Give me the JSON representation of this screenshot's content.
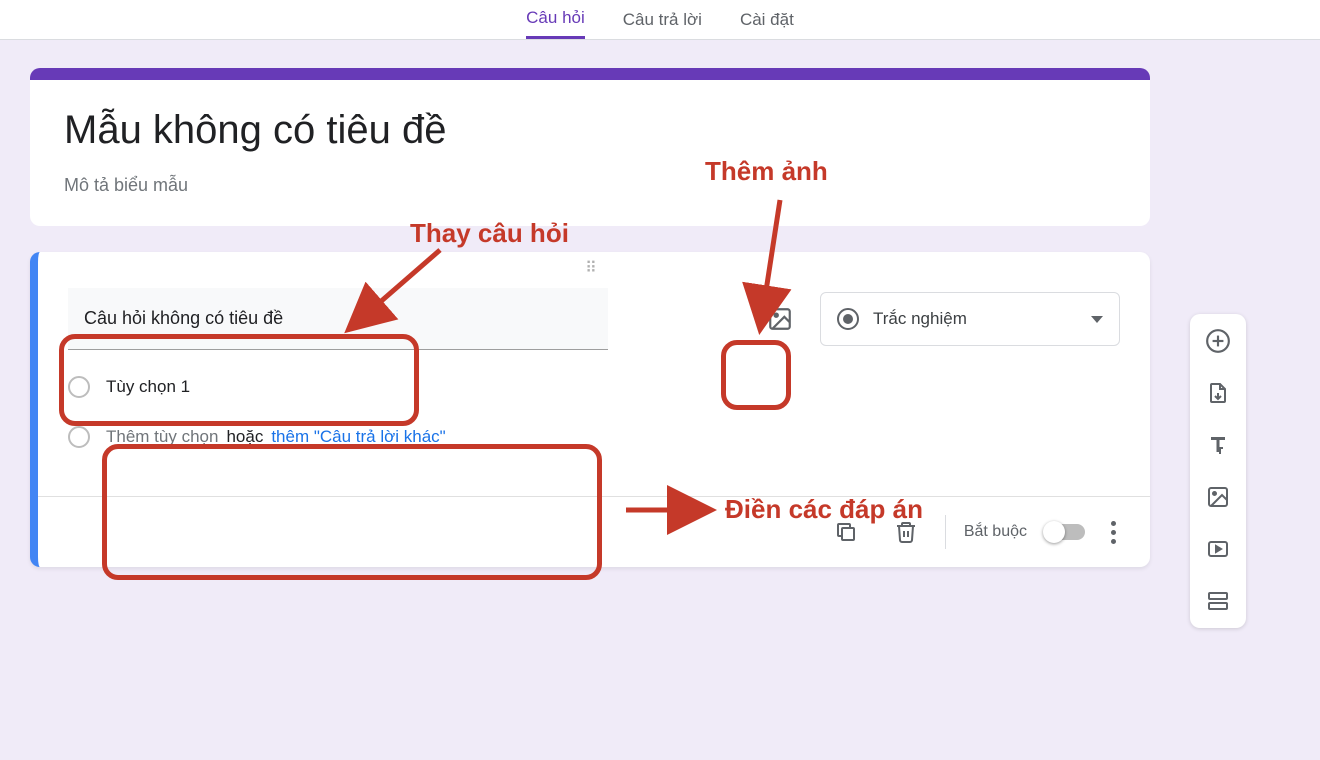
{
  "tabs": {
    "questions": "Câu hỏi",
    "responses": "Câu trả lời",
    "settings": "Cài đặt"
  },
  "form": {
    "title": "Mẫu không có tiêu đề",
    "description": "Mô tả biểu mẫu"
  },
  "question": {
    "title": "Câu hỏi không có tiêu đề",
    "type_label": "Trắc nghiệm",
    "option1": "Tùy chọn 1",
    "add_option": "Thêm tùy chọn",
    "or": "hoặc",
    "add_other": "thêm \"Câu trả lời khác\"",
    "required_label": "Bắt buộc"
  },
  "annotations": {
    "change_question": "Thay câu hỏi",
    "add_image": "Thêm ảnh",
    "fill_answers": "Điền các đáp án"
  }
}
